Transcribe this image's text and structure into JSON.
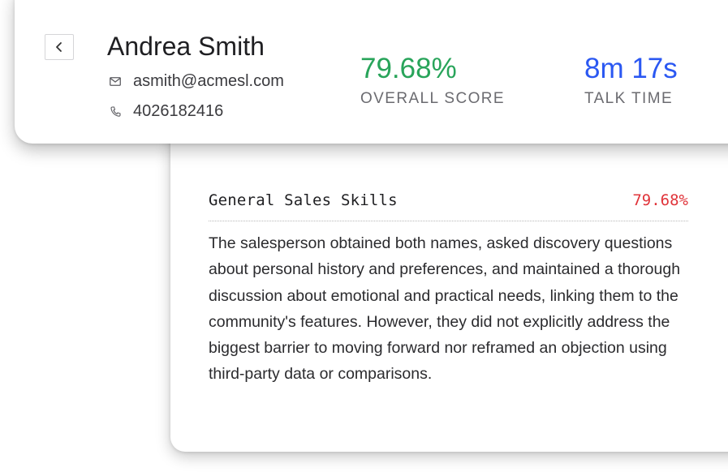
{
  "profile": {
    "name": "Andrea Smith",
    "email": "asmith@acmesl.com",
    "phone": "4026182416",
    "back_icon": "chevron-left-icon",
    "email_icon": "mail-icon",
    "phone_icon": "phone-icon"
  },
  "metrics": {
    "overall_score": {
      "value": "79.68%",
      "label": "OVERALL SCORE",
      "color": "#28a45a"
    },
    "talk_time": {
      "value": "8m 17s",
      "label": "TALK TIME",
      "color": "#2b58f2"
    }
  },
  "skill": {
    "name": "General Sales Skills",
    "score": "79.68%",
    "score_color": "#e0343a",
    "description": "The salesperson obtained both names, asked discovery questions about personal history and preferences, and maintained a thorough discussion about emotional and practical needs, linking them to the community's features. However, they did not explicitly address the biggest barrier to moving forward nor reframed an objection using third-party data or comparisons."
  }
}
